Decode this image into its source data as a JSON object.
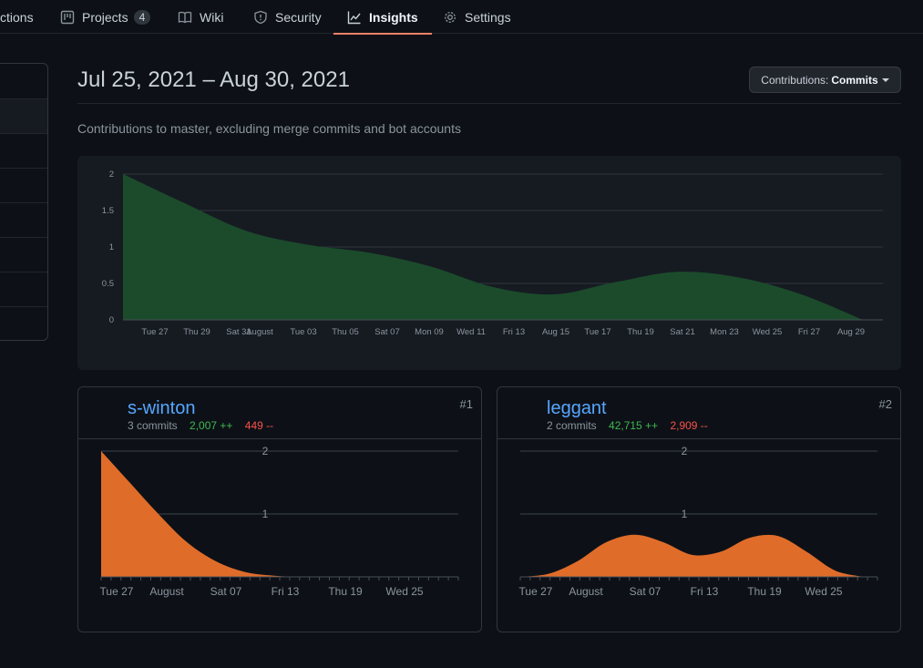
{
  "nav": {
    "tabs": [
      {
        "label": "ctions",
        "icon": "actions-icon"
      },
      {
        "label": "Projects",
        "icon": "project-icon",
        "count": "4"
      },
      {
        "label": "Wiki",
        "icon": "book-icon"
      },
      {
        "label": "Security",
        "icon": "shield-icon"
      },
      {
        "label": "Insights",
        "icon": "graph-icon",
        "active": true
      },
      {
        "label": "Settings",
        "icon": "gear-icon"
      }
    ]
  },
  "header": {
    "date_range": "Jul 25, 2021 – Aug 30, 2021",
    "contrib_select_prefix": "Contributions:",
    "contrib_select_value": "Commits",
    "subtitle": "Contributions to master, excluding merge commits and bot accounts"
  },
  "colors": {
    "accent": "#f78166",
    "area_main": "#1c4b2b",
    "area_contributor": "#e06c2a",
    "link": "#58a6ff",
    "additions": "#3fb950",
    "deletions": "#f85149"
  },
  "chart_data": [
    {
      "type": "area",
      "title": "",
      "y_ticks": [
        "0",
        "0.5",
        "1",
        "1.5",
        "2"
      ],
      "ylim": [
        0,
        2
      ],
      "x_ticks": [
        "Tue 27",
        "Thu 29",
        "Sat 31",
        "August",
        "Tue 03",
        "Thu 05",
        "Sat 07",
        "Mon 09",
        "Wed 11",
        "Fri 13",
        "Aug 15",
        "Tue 17",
        "Thu 19",
        "Sat 21",
        "Mon 23",
        "Wed 25",
        "Fri 27",
        "Aug 29"
      ],
      "x": [
        "Jul 25",
        "Jul 28",
        "Jul 31",
        "Aug 03",
        "Aug 06",
        "Aug 09",
        "Aug 12",
        "Aug 15",
        "Aug 18",
        "Aug 21",
        "Aug 24",
        "Aug 27",
        "Aug 30"
      ],
      "series": [
        {
          "values": [
            2,
            1.6,
            1.22,
            1.03,
            0.92,
            0.73,
            0.45,
            0.35,
            0.52,
            0.66,
            0.58,
            0.35,
            0.0
          ]
        }
      ],
      "grid": true
    },
    {
      "type": "area",
      "contributor": "s-winton",
      "y_ticks": [
        "1",
        "2"
      ],
      "ylim": [
        0,
        2
      ],
      "x_ticks": [
        "Tue 27",
        "August",
        "Sat 07",
        "Fri 13",
        "Thu 19",
        "Wed 25"
      ],
      "x": [
        "Jul 25",
        "Jul 28",
        "Jul 31",
        "Aug 03",
        "Aug 06",
        "Aug 09",
        "Aug 12",
        "Aug 15",
        "Aug 18",
        "Aug 21",
        "Aug 24",
        "Aug 27",
        "Aug 30"
      ],
      "series": [
        {
          "values": [
            2,
            1.5,
            1.0,
            0.55,
            0.25,
            0.08,
            0.02,
            0,
            0,
            0,
            0,
            0,
            0
          ]
        }
      ]
    },
    {
      "type": "area",
      "contributor": "leggant",
      "y_ticks": [
        "1",
        "2"
      ],
      "ylim": [
        0,
        2
      ],
      "x_ticks": [
        "Tue 27",
        "August",
        "Sat 07",
        "Fri 13",
        "Thu 19",
        "Wed 25"
      ],
      "x": [
        "Jul 25",
        "Jul 28",
        "Jul 31",
        "Aug 03",
        "Aug 06",
        "Aug 09",
        "Aug 12",
        "Aug 15",
        "Aug 18",
        "Aug 21",
        "Aug 24",
        "Aug 27",
        "Aug 30"
      ],
      "series": [
        {
          "values": [
            0,
            0.05,
            0.25,
            0.55,
            0.67,
            0.55,
            0.35,
            0.4,
            0.62,
            0.65,
            0.4,
            0.1,
            0
          ]
        }
      ]
    }
  ],
  "contributors": [
    {
      "name": "s-winton",
      "commits": "3 commits",
      "additions": "2,007 ++",
      "deletions": "449 --",
      "rank": "#1",
      "avatar": "pixel-avatar"
    },
    {
      "name": "leggant",
      "commits": "2 commits",
      "additions": "42,715 ++",
      "deletions": "2,909 --",
      "rank": "#2",
      "avatar": "earth-avatar"
    }
  ]
}
